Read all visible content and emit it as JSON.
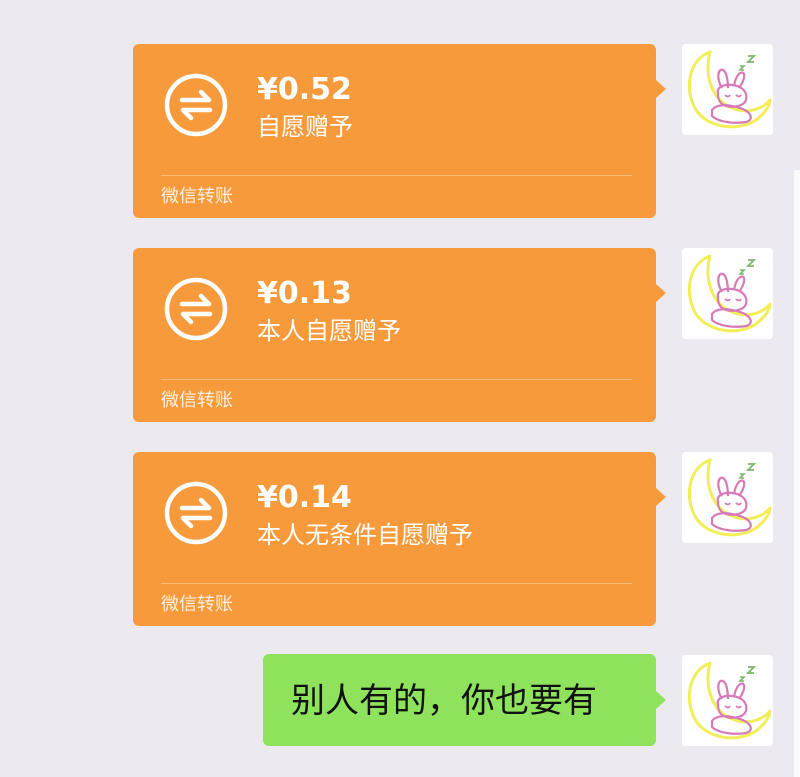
{
  "colors": {
    "background": "#ece9f0",
    "transfer_card": "#f79a3c",
    "text_bubble": "#8ee25c"
  },
  "messages": [
    {
      "type": "transfer",
      "amount": "¥0.52",
      "note": "自愿赠予",
      "footer": "微信转账",
      "icon": "transfer-arrows-icon"
    },
    {
      "type": "transfer",
      "amount": "¥0.13",
      "note": "本人自愿赠予",
      "footer": "微信转账",
      "icon": "transfer-arrows-icon"
    },
    {
      "type": "transfer",
      "amount": "¥0.14",
      "note": "本人无条件自愿赠予",
      "footer": "微信转账",
      "icon": "transfer-arrows-icon"
    },
    {
      "type": "text",
      "text": "别人有的，你也要有"
    }
  ],
  "avatar": {
    "icon": "sleeping-bunny-avatar-icon"
  }
}
